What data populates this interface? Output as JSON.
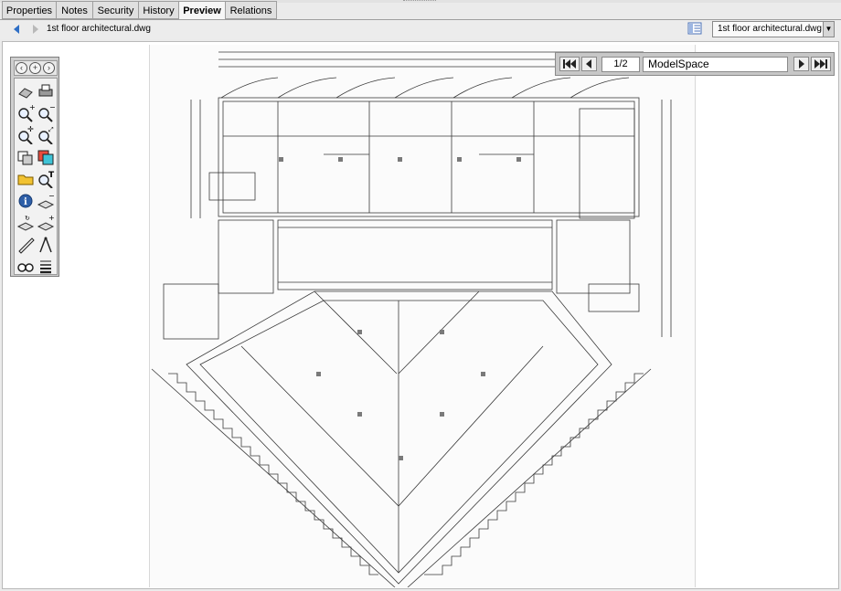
{
  "tabs": [
    {
      "label": "Properties",
      "active": false
    },
    {
      "label": "Notes",
      "active": false
    },
    {
      "label": "Security",
      "active": false
    },
    {
      "label": "History",
      "active": false
    },
    {
      "label": "Preview",
      "active": true
    },
    {
      "label": "Relations",
      "active": false
    }
  ],
  "preview": {
    "filename": "1st floor architectural.dwg",
    "selected_file": "1st floor architectural.dwg"
  },
  "navigator": {
    "page": "1/2",
    "space": "ModelSpace"
  },
  "tool_icons": [
    "pan-left-icon",
    "pan-center-icon",
    "pan-right-icon",
    "erase-icon",
    "print-icon",
    "zoom-in-icon",
    "zoom-out-icon",
    "zoom-pan-icon",
    "zoom-extents-icon",
    "layers-icon",
    "layer-colors-icon",
    "open-folder-icon",
    "find-text-icon",
    "info-icon",
    "layer-minus-icon",
    "layer-refresh-icon",
    "layer-plus-icon",
    "measure-ruler-icon",
    "compass-icon",
    "binoculars-icon",
    "line-weight-icon"
  ],
  "colors": {
    "background": "#ebebeb",
    "tab_active": "#f6f6f6",
    "drawing_line": "#3a3a3a"
  }
}
